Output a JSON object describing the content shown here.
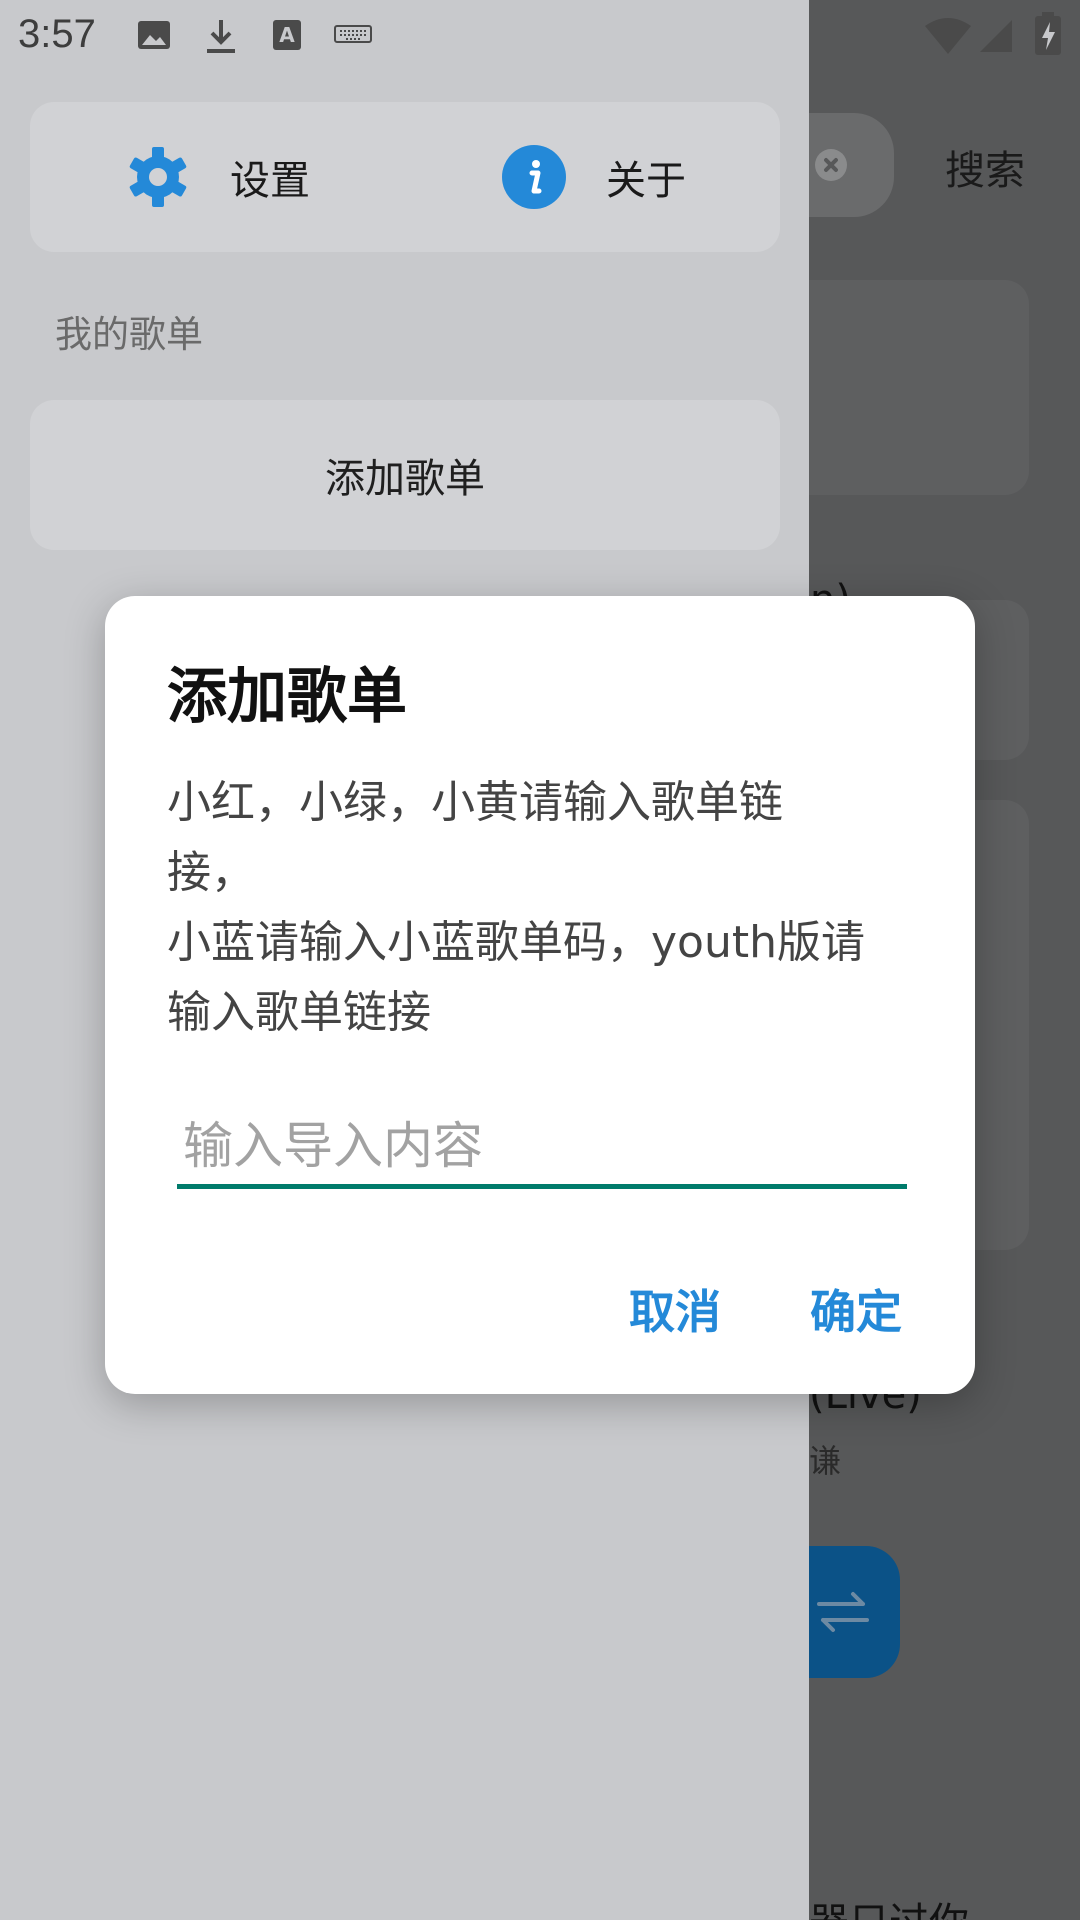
{
  "status_bar": {
    "time": "3:57"
  },
  "background_app": {
    "search_label": "搜索",
    "fragment_text": "n)",
    "song_title_fragment": "(Live)",
    "song_artist_fragment": "谦",
    "bottom_text_fragment": "器只过你"
  },
  "drawer": {
    "settings_label": "设置",
    "about_label": "关于",
    "section_title": "我的歌单",
    "add_playlist_label": "添加歌单"
  },
  "dialog": {
    "title": "添加歌单",
    "message_lines": [
      "小红，小绿，小黄请输入歌单链",
      "接，",
      "小蓝请输入小蓝歌单码，youth版请",
      "输入歌单链接"
    ],
    "input_value": "",
    "input_placeholder": "输入导入内容",
    "cancel_label": "取消",
    "ok_label": "确定"
  },
  "colors": {
    "accent": "#2489d8",
    "input_underline": "#007b6b",
    "scrim": "#c8c9cc"
  }
}
